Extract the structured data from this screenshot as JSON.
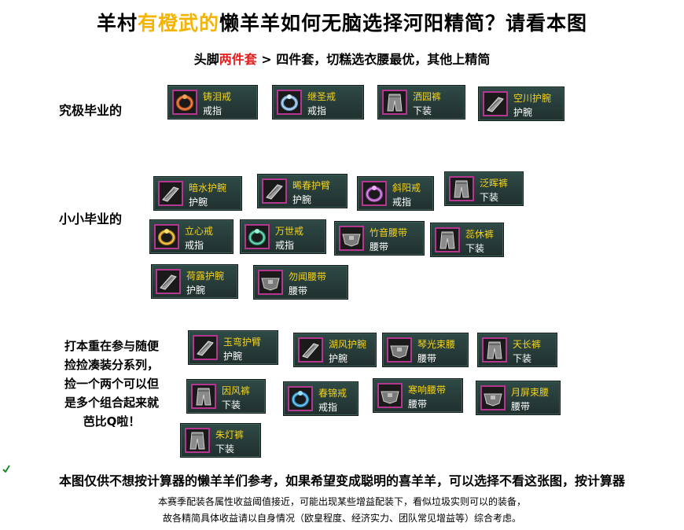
{
  "title": {
    "part1": "羊村",
    "highlight": "有橙武的",
    "part2": "懒羊羊如何无脑选择河阳精简？请看本图"
  },
  "subtitle": {
    "part1": "头脚",
    "red": "两件套",
    "part2": " > 四件套，切糕选衣腰最优，其他上精简"
  },
  "sections": {
    "ultimate": "究极毕业的",
    "small": "小小毕业的",
    "note_lines": [
      "打本重在参与随便",
      "捡捡凑装分系列，",
      "捡一个两个可以但",
      "是多个组合起来就",
      "芭比Q啦！"
    ]
  },
  "items": [
    {
      "name": "铸泪戒",
      "type": "戒指",
      "icon": "ring-orange-icon"
    },
    {
      "name": "继圣戒",
      "type": "戒指",
      "icon": "ring-blue-icon"
    },
    {
      "name": "洒园裤",
      "type": "下装",
      "icon": "pants-icon"
    },
    {
      "name": "空川护腕",
      "type": "护腕",
      "icon": "bracer-icon"
    },
    {
      "name": "暗水护腕",
      "type": "护腕",
      "icon": "bracer-icon"
    },
    {
      "name": "晞春护臂",
      "type": "护腕",
      "icon": "bracer-icon"
    },
    {
      "name": "斜阳戒",
      "type": "戒指",
      "icon": "ring-purple-icon"
    },
    {
      "name": "泛晖裤",
      "type": "下装",
      "icon": "pants-icon"
    },
    {
      "name": "立心戒",
      "type": "戒指",
      "icon": "ring-gold-icon"
    },
    {
      "name": "万世戒",
      "type": "戒指",
      "icon": "ring-teal-icon"
    },
    {
      "name": "竹音腰带",
      "type": "腰带",
      "icon": "belt-icon"
    },
    {
      "name": "蕊休裤",
      "type": "下装",
      "icon": "pants-icon"
    },
    {
      "name": "荷露护腕",
      "type": "护腕",
      "icon": "bracer-icon"
    },
    {
      "name": "勿闻腰带",
      "type": "腰带",
      "icon": "belt-icon"
    },
    {
      "name": "玉弯护臂",
      "type": "护腕",
      "icon": "bracer-icon"
    },
    {
      "name": "湖风护腕",
      "type": "护腕",
      "icon": "bracer-icon"
    },
    {
      "name": "琴光束腰",
      "type": "腰带",
      "icon": "belt-icon"
    },
    {
      "name": "天长裤",
      "type": "下装",
      "icon": "pants-icon"
    },
    {
      "name": "因风裤",
      "type": "下装",
      "icon": "pants-icon"
    },
    {
      "name": "春锦戒",
      "type": "戒指",
      "icon": "ring-cyan-icon"
    },
    {
      "name": "寒响腰带",
      "type": "腰带",
      "icon": "belt-icon"
    },
    {
      "name": "月屏束腰",
      "type": "腰带",
      "icon": "belt-icon"
    },
    {
      "name": "朱灯裤",
      "type": "下装",
      "icon": "pants-icon"
    }
  ],
  "footer": {
    "main": "本图仅供不想按计算器的懒羊羊们参考，如果希望变成聪明的喜羊羊，可以选择不看这张图，按计算器",
    "line1": "本赛季配装各属性收益阈值接近，可能出现某些增益配装下，看似垃圾实则可以的装备，",
    "line2": "故各精简具体收益请以自身情况（欧皇程度、经济实力、团队常见增益等）综合考虑。"
  },
  "colors": {
    "title_highlight": "#f5b400",
    "subtitle_red": "#e41e1e",
    "item_name": "#f4d21a",
    "item_bg": "#2a403d",
    "icon_border": "#b3368f"
  }
}
